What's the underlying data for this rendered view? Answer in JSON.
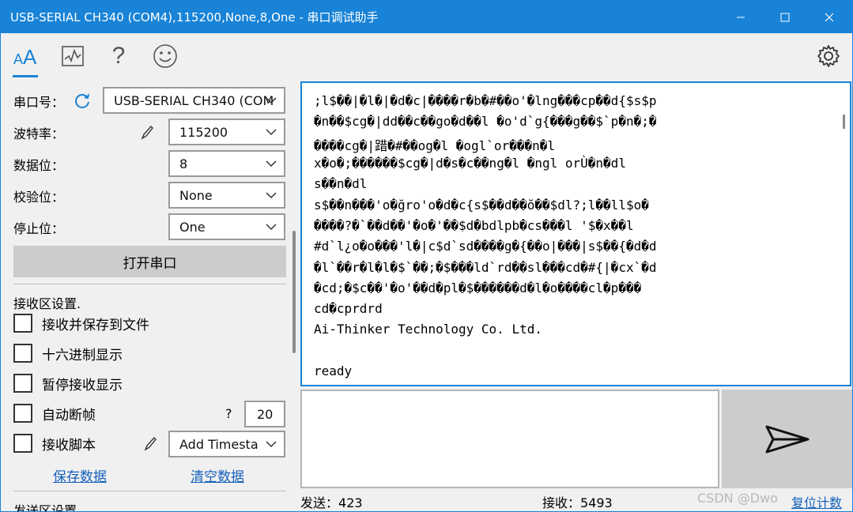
{
  "window": {
    "title": "USB-SERIAL CH340 (COM4),115200,None,8,One - 串口调试助手",
    "minimize_label": "minimize",
    "maximize_label": "maximize",
    "close_label": "close"
  },
  "toolbar": {
    "icons": [
      "font-icon",
      "chart-icon",
      "help-icon",
      "smiley-icon",
      "gear-icon"
    ],
    "help_glyph": "?"
  },
  "left": {
    "port_label": "串口号：",
    "port_value": "USB-SERIAL CH340 (COM",
    "baud_label": "波特率：",
    "baud_value": "115200",
    "databits_label": "数据位：",
    "databits_value": "8",
    "parity_label": "校验位：",
    "parity_value": "None",
    "stopbits_label": "停止位：",
    "stopbits_value": "One",
    "open_button": "打开串口",
    "recv_section": "接收区设置.",
    "cb_save_file": "接收并保存到文件",
    "cb_hex": "十六进制显示",
    "cb_pause": "暂停接收显示",
    "cb_autobreak": "自动断帧",
    "autobreak_help": "?",
    "autobreak_value": "20",
    "cb_script": "接收脚本",
    "script_value": "Add Timesta",
    "save_data": "保存数据",
    "clear_data": "清空数据",
    "send_section": "发送区设置"
  },
  "receive": {
    "lines": [
      ";l$��|�l�|�d�c|����r�b�#��o'�lng���cp��d{$s$p",
      "�n��$cg�|dd��c��go�d��l �o'd`g{���g��$`p�n�;�",
      "����cg�|踖�#��og�l �ogl`or���n�l",
      "x�o�;������$cg�|d�s�c��ng�l �ngl orÙ�n�dl",
      "s��n�dl",
      "s$��n���'o�ğro'o�d�c{s$��d��ŏ��$dl?;l��ll$o�",
      "����?�`��d��'�o�'��$d�bdlpb�cs���l '$�x��l",
      "#d`l¿o�o���'l�|c$d`sd����g�{��o|���|s$��{�d�d",
      "�l`��r�l�l�$`��;�$���ld`rd��sl���cd�#{|�cx`�d",
      "�cd;�$c��'�o'��d�pl�$������d�l�o����cl�p���",
      "cd�cprdrd",
      "Ai-Thinker Technology Co. Ltd.",
      "",
      "ready"
    ]
  },
  "status": {
    "sent_label": "发送：",
    "sent_value": "423",
    "recv_label": "接收：",
    "recv_value": "5493",
    "reset_label": "复位计数",
    "watermark": "CSDN @Dwo"
  }
}
